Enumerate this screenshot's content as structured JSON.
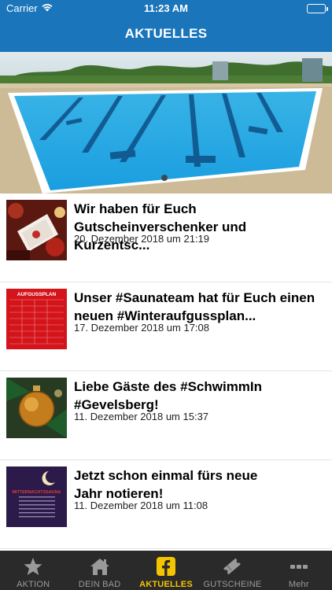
{
  "status_bar": {
    "carrier": "Carrier",
    "time": "11:23 AM"
  },
  "nav": {
    "title": "AKTUELLES"
  },
  "colors": {
    "header": "#1a75bb",
    "tabbar": "#2a2a2a",
    "tab_active": "#f5c400",
    "tab_inactive": "#9a9a9a"
  },
  "news": [
    {
      "title": "Wir haben für Euch\nGutscheinverschenker und Kurzentsc...",
      "date": "20. Dezember 2018 um 21:19",
      "thumb": "gift-voucher-image"
    },
    {
      "title": "Unser #Saunateam hat für Euch einen\nneuen #Winteraufgussplan...",
      "date": "17. Dezember 2018 um 17:08",
      "thumb": "aufgussplan-image",
      "thumb_text": "AUFGUSSPLAN"
    },
    {
      "title": "Liebe Gäste des #SchwimmIn\n#Gevelsberg!",
      "date": "11. Dezember 2018 um 15:37",
      "thumb": "christmas-bauble-image"
    },
    {
      "title": "Jetzt schon einmal fürs neue\nJahr notieren!",
      "date": "11. Dezember 2018 um 11:08",
      "thumb": "mitternachtssauna-image",
      "thumb_text": "MITTERNACHTSSAUNA"
    }
  ],
  "tabs": [
    {
      "label": "AKTION",
      "icon": "star-icon",
      "active": false
    },
    {
      "label": "DEIN BAD",
      "icon": "home-icon",
      "active": false
    },
    {
      "label": "AKTUELLES",
      "icon": "facebook-icon",
      "active": true
    },
    {
      "label": "GUTSCHEINE",
      "icon": "ticket-icon",
      "active": false
    },
    {
      "label": "Mehr",
      "icon": "more-icon",
      "active": false
    }
  ]
}
